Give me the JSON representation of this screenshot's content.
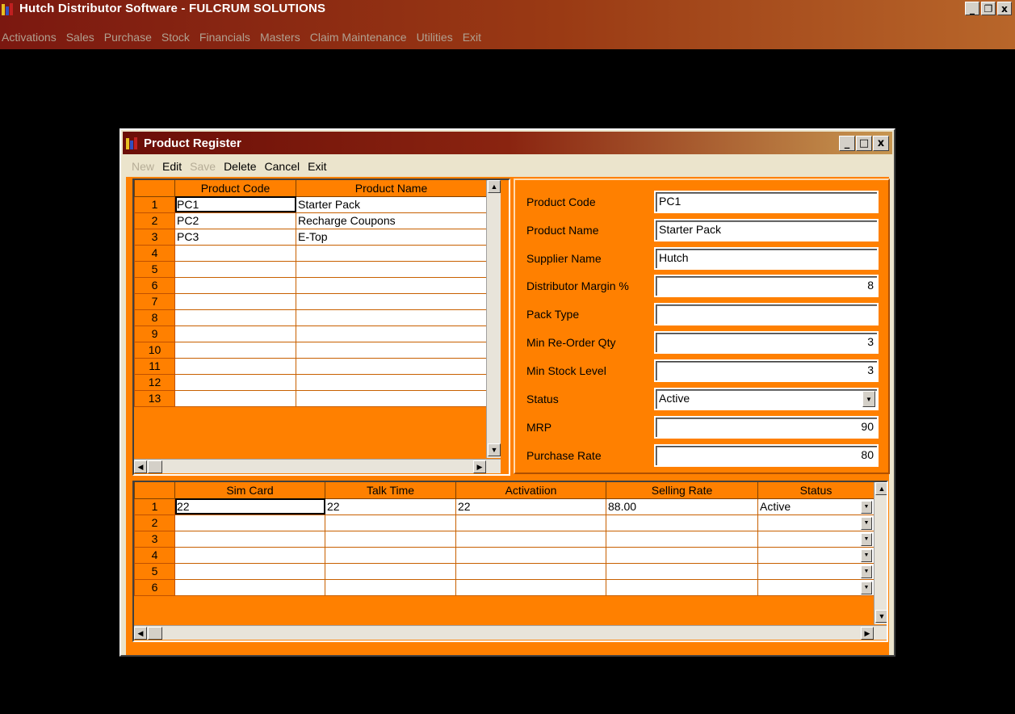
{
  "app": {
    "title": "Hutch Distributor Software - FULCRUM SOLUTIONS",
    "window_buttons": [
      "_",
      "❐",
      "x"
    ],
    "menu": [
      "Activations",
      "Sales",
      "Purchase",
      "Stock",
      "Financials",
      "Masters",
      "Claim Maintenance",
      "Utilities",
      "Exit"
    ]
  },
  "child": {
    "title": "Product Register",
    "window_buttons": [
      "_",
      "□",
      "x"
    ],
    "menu": {
      "new": "New",
      "edit": "Edit",
      "save": "Save",
      "delete": "Delete",
      "cancel": "Cancel",
      "exit": "Exit"
    },
    "product_grid": {
      "headers": [
        "Product Code",
        "Product Name"
      ],
      "rows": [
        {
          "num": "1",
          "code": "PC1",
          "name": "Starter Pack"
        },
        {
          "num": "2",
          "code": "PC2",
          "name": "Recharge Coupons"
        },
        {
          "num": "3",
          "code": "PC3",
          "name": "E-Top"
        },
        {
          "num": "4",
          "code": "",
          "name": ""
        },
        {
          "num": "5",
          "code": "",
          "name": ""
        },
        {
          "num": "6",
          "code": "",
          "name": ""
        },
        {
          "num": "7",
          "code": "",
          "name": ""
        },
        {
          "num": "8",
          "code": "",
          "name": ""
        },
        {
          "num": "9",
          "code": "",
          "name": ""
        },
        {
          "num": "10",
          "code": "",
          "name": ""
        },
        {
          "num": "11",
          "code": "",
          "name": ""
        },
        {
          "num": "12",
          "code": "",
          "name": ""
        },
        {
          "num": "13",
          "code": "",
          "name": ""
        }
      ]
    },
    "fields": {
      "product_code": {
        "label": "Product Code",
        "value": "PC1"
      },
      "product_name": {
        "label": "Product Name",
        "value": "Starter Pack"
      },
      "supplier_name": {
        "label": "Supplier Name",
        "value": "Hutch"
      },
      "distributor_margin": {
        "label": "Distributor Margin %",
        "value": "8"
      },
      "pack_type": {
        "label": "Pack Type",
        "value": ""
      },
      "min_reorder_qty": {
        "label": "Min Re-Order Qty",
        "value": "3"
      },
      "min_stock_level": {
        "label": "Min Stock Level",
        "value": "3"
      },
      "status": {
        "label": "Status",
        "value": "Active"
      },
      "mrp": {
        "label": "MRP",
        "value": "90"
      },
      "purchase_rate": {
        "label": "Purchase Rate",
        "value": "80"
      }
    },
    "rate_grid": {
      "headers": [
        "Sim Card",
        "Talk Time",
        "Activatiion",
        "Selling Rate",
        "Status"
      ],
      "rows": [
        {
          "num": "1",
          "sim": "22",
          "talk": "22",
          "act": "22",
          "rate": "88.00",
          "status": "Active"
        },
        {
          "num": "2",
          "sim": "",
          "talk": "",
          "act": "",
          "rate": "",
          "status": ""
        },
        {
          "num": "3",
          "sim": "",
          "talk": "",
          "act": "",
          "rate": "",
          "status": ""
        },
        {
          "num": "4",
          "sim": "",
          "talk": "",
          "act": "",
          "rate": "",
          "status": ""
        },
        {
          "num": "5",
          "sim": "",
          "talk": "",
          "act": "",
          "rate": "",
          "status": ""
        },
        {
          "num": "6",
          "sim": "",
          "talk": "",
          "act": "",
          "rate": "",
          "status": ""
        }
      ]
    }
  },
  "colors": {
    "accent": "#ff8000",
    "title_dark": "#6b0e08",
    "desktop": "#000000"
  },
  "icons": [
    "app-icon",
    "minimize-icon",
    "restore-icon",
    "close-icon",
    "scroll-up-icon",
    "scroll-down-icon",
    "scroll-left-icon",
    "scroll-right-icon",
    "dropdown-arrow-icon"
  ]
}
